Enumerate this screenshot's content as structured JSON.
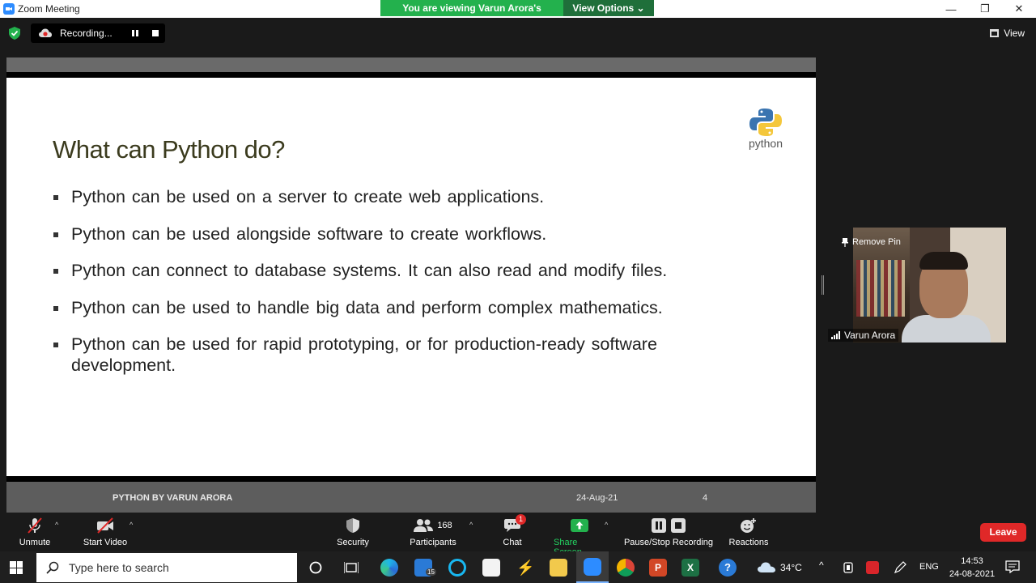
{
  "window": {
    "title": "Zoom Meeting",
    "minimize": "—",
    "restore": "❐",
    "close": "✕"
  },
  "banner": {
    "message": "You are viewing Varun Arora's screen",
    "view_options": "View Options ⌄"
  },
  "recording": {
    "label": "Recording..."
  },
  "view_button": {
    "label": "View"
  },
  "slide": {
    "title": "What can Python do?",
    "logo_word": "python",
    "bullets": [
      "Python can be used on a server to create web applications.",
      "Python can be used alongside software to create workflows.",
      "Python can connect to database systems. It can also read and modify files.",
      "Python can be used to handle big data and perform complex mathematics.",
      "Python can be used for rapid prototyping, or for production-ready software development."
    ],
    "footer": {
      "left": "PYTHON BY VARUN ARORA",
      "date": "24-Aug-21",
      "page": "4"
    }
  },
  "video": {
    "remove_pin": "Remove Pin",
    "participant_name": "Varun Arora"
  },
  "toolbar": {
    "unmute": "Unmute",
    "start_video": "Start Video",
    "security": "Security",
    "participants": "Participants",
    "participants_count": "168",
    "chat": "Chat",
    "chat_badge": "1",
    "share_screen": "Share Screen",
    "pause_stop": "Pause/Stop Recording",
    "reactions": "Reactions",
    "leave": "Leave"
  },
  "taskbar": {
    "search_placeholder": "Type here to search",
    "mail_badge": "15",
    "temperature": "34°C",
    "language": "ENG",
    "time": "14:53",
    "date": "24-08-2021"
  },
  "colors": {
    "zoom_green": "#23b14d",
    "leave_red": "#e02828",
    "zoom_blue": "#2d8cff"
  }
}
